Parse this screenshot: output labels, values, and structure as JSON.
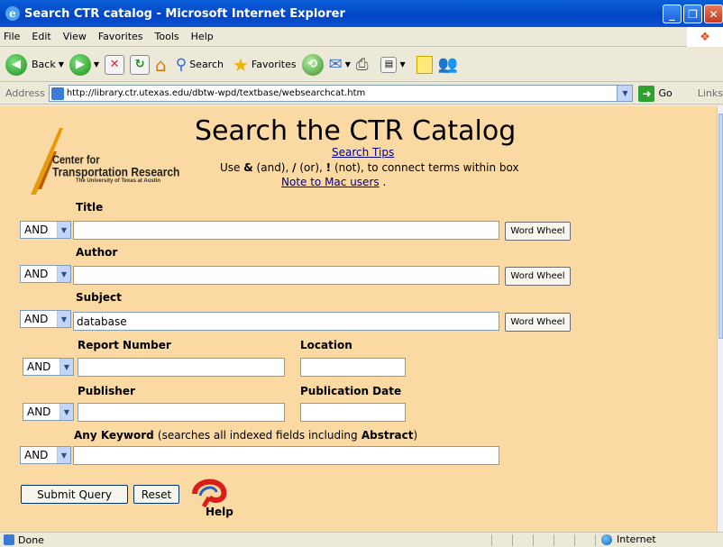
{
  "window": {
    "title": "Search CTR catalog - Microsoft Internet Explorer",
    "ie_icon": "e"
  },
  "menu": [
    "File",
    "Edit",
    "View",
    "Favorites",
    "Tools",
    "Help"
  ],
  "toolbar": {
    "back_label": "Back",
    "search_label": "Search",
    "favorites_label": "Favorites"
  },
  "address": {
    "label": "Address",
    "url": "http://library.ctr.utexas.edu/dbtw-wpd/textbase/websearchcat.htm",
    "go_label": "Go",
    "links_label": "Links"
  },
  "page": {
    "title": "Search the CTR Catalog",
    "tips_link": "Search Tips",
    "use_prefix": "Use",
    "and_sym": "&",
    "and_txt": "(and),",
    "or_sym": "/",
    "or_txt": "(or),",
    "not_sym": "!",
    "not_txt": "(not), to connect terms within box",
    "mac_link": "Note to Mac users",
    "mac_suffix": ".",
    "logo": {
      "line1": "Center for",
      "line2": "Transportation Research",
      "line3": "The University of Texas at Austin"
    }
  },
  "form": {
    "operator": "AND",
    "word_wheel_label": "Word Wheel",
    "title_label": "Title",
    "title_value": "",
    "author_label": "Author",
    "author_value": "",
    "subject_label": "Subject",
    "subject_value": "database",
    "report_label": "Report Number",
    "report_value": "",
    "location_label": "Location",
    "location_value": "",
    "publisher_label": "Publisher",
    "publisher_value": "",
    "pubdate_label": "Publication Date",
    "pubdate_value": "",
    "keyword_label": "Any Keyword",
    "keyword_note_pre": "(searches all indexed fields including",
    "keyword_note_bold": "Abstract",
    "keyword_note_post": ")",
    "keyword_value": "",
    "submit_label": "Submit Query",
    "reset_label": "Reset",
    "help_label": "Help"
  },
  "status": {
    "text": "Done",
    "zone": "Internet"
  }
}
